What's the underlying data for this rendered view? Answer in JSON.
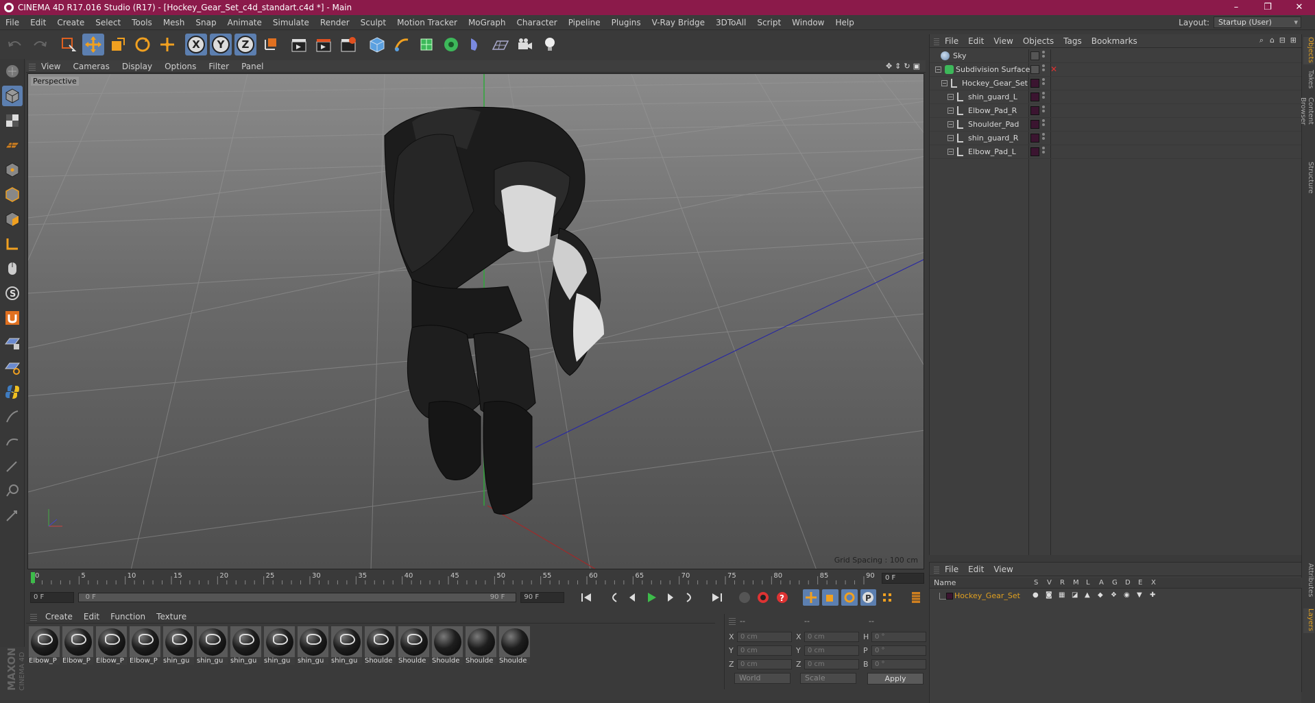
{
  "window": {
    "title": "CINEMA 4D R17.016 Studio (R17) - [Hockey_Gear_Set_c4d_standart.c4d *] - Main",
    "minimize": "–",
    "restore": "❐",
    "close": "✕"
  },
  "menubar": {
    "items": [
      "File",
      "Edit",
      "Create",
      "Select",
      "Tools",
      "Mesh",
      "Snap",
      "Animate",
      "Simulate",
      "Render",
      "Sculpt",
      "Motion Tracker",
      "MoGraph",
      "Character",
      "Pipeline",
      "Plugins",
      "V-Ray Bridge",
      "3DToAll",
      "Script",
      "Window",
      "Help"
    ],
    "layout_label": "Layout:",
    "layout_value": "Startup (User)"
  },
  "toolbar": {
    "axis_x": "X",
    "axis_y": "Y",
    "axis_z": "Z"
  },
  "viewport": {
    "menu": [
      "View",
      "Cameras",
      "Display",
      "Options",
      "Filter",
      "Panel"
    ],
    "camera_label": "Perspective",
    "grid_spacing": "Grid Spacing : 100 cm"
  },
  "timeline": {
    "ticks": [
      "0",
      "5",
      "10",
      "15",
      "20",
      "25",
      "30",
      "35",
      "40",
      "45",
      "50",
      "55",
      "60",
      "65",
      "70",
      "75",
      "80",
      "85",
      "90"
    ],
    "current_frame": "0 F",
    "start_frame": "0 F",
    "range_start": "0 F",
    "range_end": "90 F",
    "end_frame": "90 F"
  },
  "materials": {
    "menu": [
      "Create",
      "Edit",
      "Function",
      "Texture"
    ],
    "items": [
      {
        "name": "Elbow_P",
        "white": true
      },
      {
        "name": "Elbow_P",
        "white": true
      },
      {
        "name": "Elbow_P",
        "white": true
      },
      {
        "name": "Elbow_P",
        "white": true
      },
      {
        "name": "shin_gu",
        "white": true
      },
      {
        "name": "shin_gu",
        "white": true
      },
      {
        "name": "shin_gu",
        "white": true
      },
      {
        "name": "shin_gu",
        "white": true
      },
      {
        "name": "shin_gu",
        "white": true
      },
      {
        "name": "shin_gu",
        "white": true
      },
      {
        "name": "Shoulde",
        "white": true
      },
      {
        "name": "Shoulde",
        "white": true
      },
      {
        "name": "Shoulde",
        "white": false
      },
      {
        "name": "Shoulde",
        "white": false
      },
      {
        "name": "Shoulde",
        "white": false
      }
    ],
    "brand_top": "MAXON",
    "brand_bottom": "CINEMA 4D"
  },
  "coordinates": {
    "head": [
      "--",
      "--",
      "--"
    ],
    "rows": [
      {
        "a1": "X",
        "v1": "0 cm",
        "a2": "X",
        "v2": "0 cm",
        "a3": "H",
        "v3": "0 °"
      },
      {
        "a1": "Y",
        "v1": "0 cm",
        "a2": "Y",
        "v2": "0 cm",
        "a3": "P",
        "v3": "0 °"
      },
      {
        "a1": "Z",
        "v1": "0 cm",
        "a2": "Z",
        "v2": "0 cm",
        "a3": "B",
        "v3": "0 °"
      }
    ],
    "space": "World",
    "mode": "Scale",
    "apply": "Apply"
  },
  "objects": {
    "menu": [
      "File",
      "Edit",
      "View",
      "Objects",
      "Tags",
      "Bookmarks"
    ],
    "items": [
      {
        "name": "Sky",
        "depth": 0
      },
      {
        "name": "Subdivision Surface",
        "depth": 0
      },
      {
        "name": "Hockey_Gear_Set",
        "depth": 1
      },
      {
        "name": "shin_guard_L",
        "depth": 2
      },
      {
        "name": "Elbow_Pad_R",
        "depth": 2
      },
      {
        "name": "Shoulder_Pad",
        "depth": 2
      },
      {
        "name": "shin_guard_R",
        "depth": 2
      },
      {
        "name": "Elbow_Pad_L",
        "depth": 2
      }
    ]
  },
  "side_tabs": [
    "Objects",
    "Takes",
    "Content Browser",
    "Structure"
  ],
  "side_tabs_bottom": [
    "Attributes",
    "Layers"
  ],
  "layers": {
    "menu": [
      "File",
      "Edit",
      "View"
    ],
    "header_name": "Name",
    "columns": [
      "S",
      "V",
      "R",
      "M",
      "L",
      "A",
      "G",
      "D",
      "E",
      "X"
    ],
    "row_name": "Hockey_Gear_Set"
  },
  "colors": {
    "titlebar": "#8b1a4a",
    "accent_blue": "#5c7fb0",
    "accent_orange": "#e0a020",
    "layer_color": "#3b1530"
  }
}
